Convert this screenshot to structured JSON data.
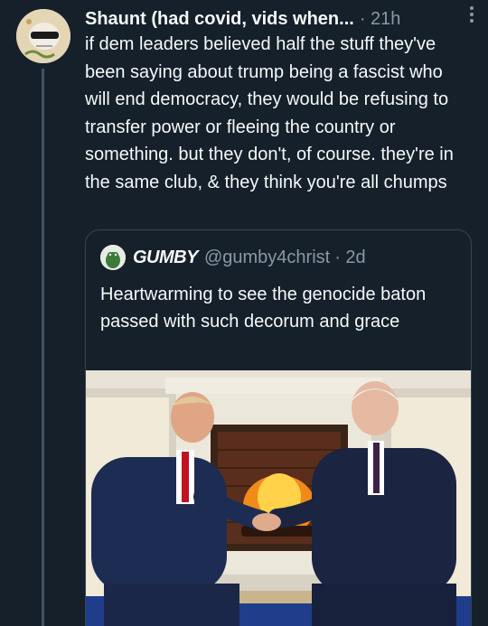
{
  "tweet": {
    "author_display_name": "Shaunt (had covid, vids when...",
    "timestamp": "· 21h",
    "text": "if dem leaders believed half the stuff they've been saying about trump being a fascist who will end democracy, they would be refusing to transfer power or fleeing the country or something. but they don't, of course. they're in the same club, & they think you're all chumps",
    "avatar_icon": "skull-sunglasses-avatar",
    "more_icon": "more-vertical-icon"
  },
  "quote": {
    "author_display_name": "GUMBY",
    "author_handle": "@gumby4christ",
    "timestamp": "· 2d",
    "text": "Heartwarming to see the genocide baton passed with such decorum and grace",
    "avatar_icon": "frog-avatar",
    "media_description_icon": "photo-two-men-shaking-hands-by-fireplace"
  },
  "colors": {
    "background": "#15202b",
    "primary_text": "#f7f9f9",
    "secondary_text": "#8b98a5",
    "border": "#38444d",
    "thread_line": "#425364"
  }
}
